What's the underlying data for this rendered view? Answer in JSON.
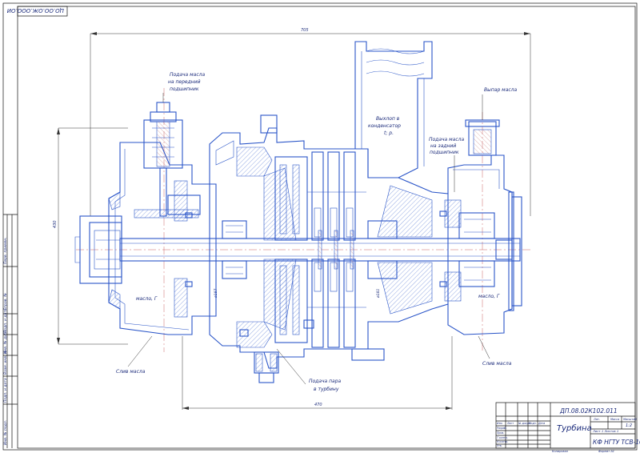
{
  "sheet": {
    "stamp_rotated": "ЦО.ОО.ОЖ.ООО.ОИ",
    "doc_number": "ДП.08.02К102.011",
    "drawing_title": "Турбина",
    "organization": "КФ НГТУ ТСВ-10",
    "scale": "1:2",
    "sheet_info": "Лист 1   Листов 1",
    "mass_label": "Масса",
    "scale_label": "Масштаб",
    "lit_label": "Лит.",
    "sheet_label": "Лист",
    "sheets_label": "Листов",
    "copied_label": "Копировал",
    "format_label": "Формат   A1",
    "rows": [
      "Изм.",
      "Лист",
      "№ докум.",
      "Подп.",
      "Дата",
      "Разраб.",
      "Пров.",
      "Т.контр.",
      "Н.контр.",
      "Утв."
    ]
  },
  "dimensions": {
    "overall_length": "705",
    "overall_height": "430",
    "mid_length": "470",
    "dia_left": "ø187",
    "dia_right": "ø181"
  },
  "annotations": {
    "oil_front_bearing": [
      "Подача масла",
      "на передний",
      "подшипник"
    ],
    "exhaust_condenser": [
      "Выхлоп в",
      "конденсатор",
      "t; p."
    ],
    "oil_rear_bearing": [
      "Подача масла",
      "на задний",
      "подшипник"
    ],
    "oil_vapor": "Выпар масла",
    "steam_supply": [
      "Подача пара",
      "в турбину"
    ],
    "oil_drain_left": "Слив масла",
    "oil_drain_right": "Слив масла",
    "oil_left": "масло, Г",
    "oil_right": "масло, Г"
  },
  "margin_labels": [
    "Перв. примен.",
    "Справ. №",
    "Подп. и дата",
    "Инв. № дубл.",
    "Взам. инв. №",
    "Подп. и дата",
    "Инв. № подл."
  ]
}
